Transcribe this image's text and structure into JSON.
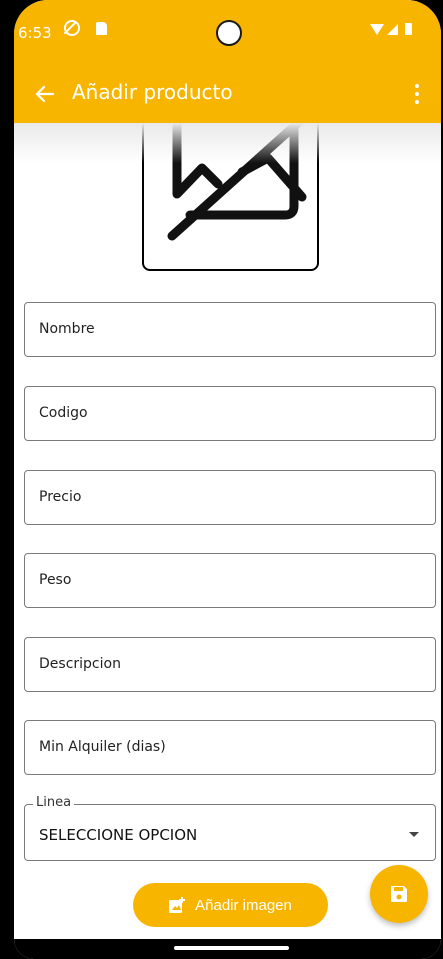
{
  "status_bar": {
    "time": "6:53",
    "icons": [
      "dnd-icon",
      "sd-card-icon",
      "camera-cutout",
      "wifi-icon",
      "signal-icon",
      "battery-icon"
    ]
  },
  "app_bar": {
    "title": "Añadir producto",
    "back_icon": "arrow-back-icon",
    "menu_icon": "more-vert-icon",
    "color": "#F7B500"
  },
  "image_preview": {
    "icon": "image-placeholder-icon"
  },
  "form": {
    "fields": [
      {
        "placeholder": "Nombre",
        "value": ""
      },
      {
        "placeholder": "Codigo",
        "value": ""
      },
      {
        "placeholder": "Precio",
        "value": ""
      },
      {
        "placeholder": "Peso",
        "value": ""
      },
      {
        "placeholder": "Descripcion",
        "value": ""
      },
      {
        "placeholder": "Min Alquiler (dias)",
        "value": ""
      }
    ],
    "linea": {
      "label": "Linea",
      "selected": "SELECCIONE OPCION"
    }
  },
  "actions": {
    "add_image_label": "Añadir imagen",
    "add_image_icon": "add-photo-icon",
    "save_icon": "save-icon"
  }
}
